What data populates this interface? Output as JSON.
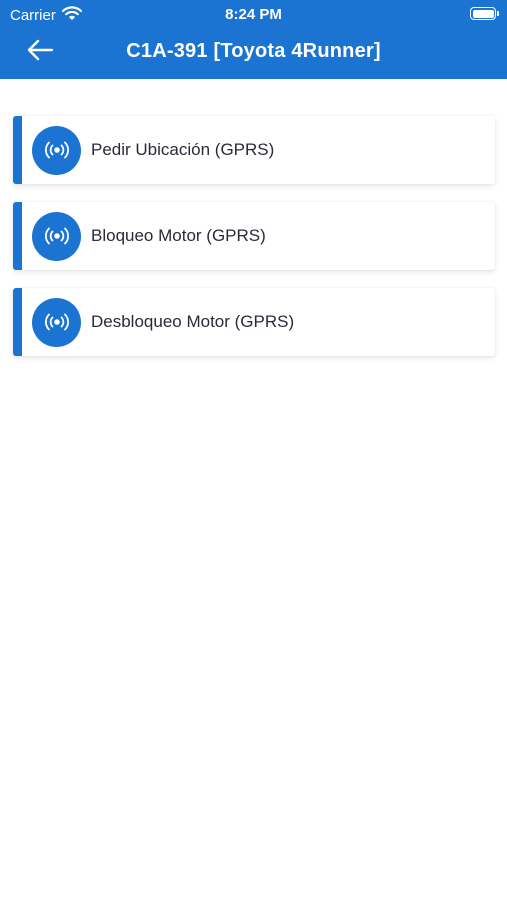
{
  "status_bar": {
    "carrier": "Carrier",
    "time": "8:24 PM",
    "icons": [
      "wifi-icon",
      "battery-icon"
    ]
  },
  "header": {
    "title": "C1A-391 [Toyota 4Runner]",
    "back_icon": "arrow-left-icon"
  },
  "commands": [
    {
      "label": "Pedir Ubicación (GPRS)",
      "icon": "broadcast-icon"
    },
    {
      "label": "Bloqueo Motor (GPRS)",
      "icon": "broadcast-icon"
    },
    {
      "label": "Desbloqueo Motor (GPRS)",
      "icon": "broadcast-icon"
    }
  ],
  "colors": {
    "primary": "#1c74d2",
    "text": "#2a2a3a",
    "background": "#ffffff"
  }
}
